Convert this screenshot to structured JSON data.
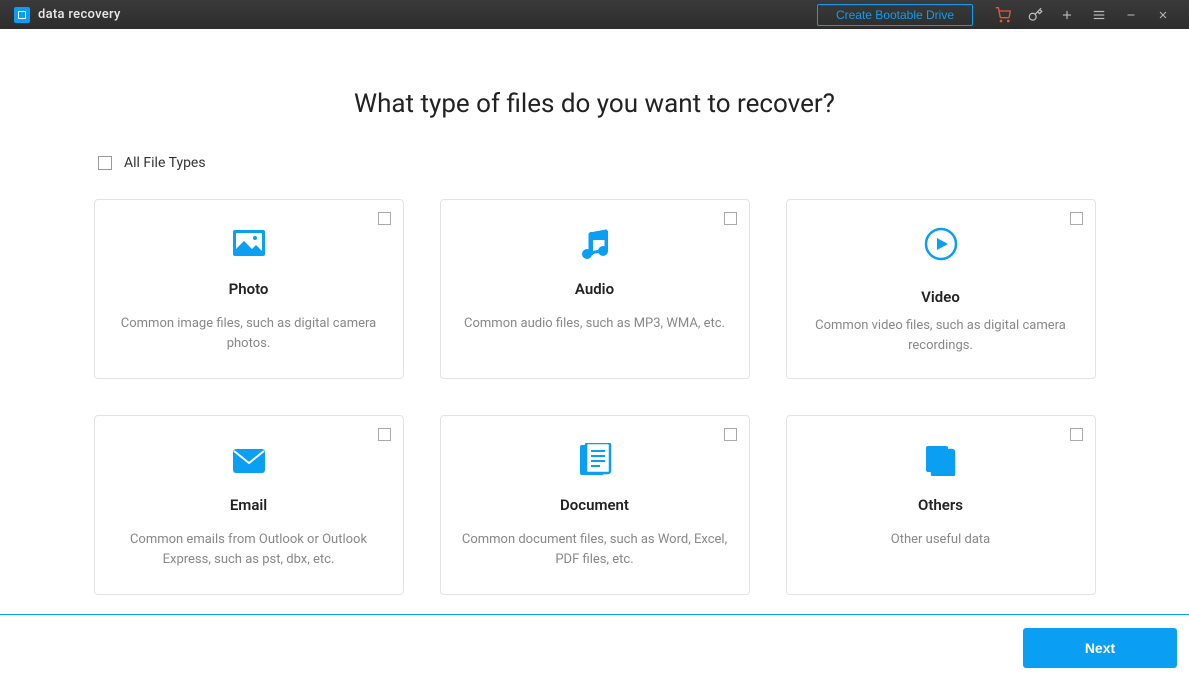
{
  "app": {
    "title": "data recovery"
  },
  "titlebar": {
    "bootable_label": "Create Bootable Drive"
  },
  "heading": "What type of files do you want to recover?",
  "all_types_label": "All File Types",
  "cards": {
    "photo": {
      "title": "Photo",
      "desc": "Common image files, such as digital camera photos."
    },
    "audio": {
      "title": "Audio",
      "desc": "Common audio files, such as MP3, WMA, etc."
    },
    "video": {
      "title": "Video",
      "desc": "Common video files, such as digital camera recordings."
    },
    "email": {
      "title": "Email",
      "desc": "Common emails from Outlook or Outlook Express, such as pst, dbx, etc."
    },
    "document": {
      "title": "Document",
      "desc": "Common document files, such as Word, Excel, PDF files, etc."
    },
    "others": {
      "title": "Others",
      "desc": "Other useful data"
    }
  },
  "footer": {
    "next_label": "Next"
  }
}
